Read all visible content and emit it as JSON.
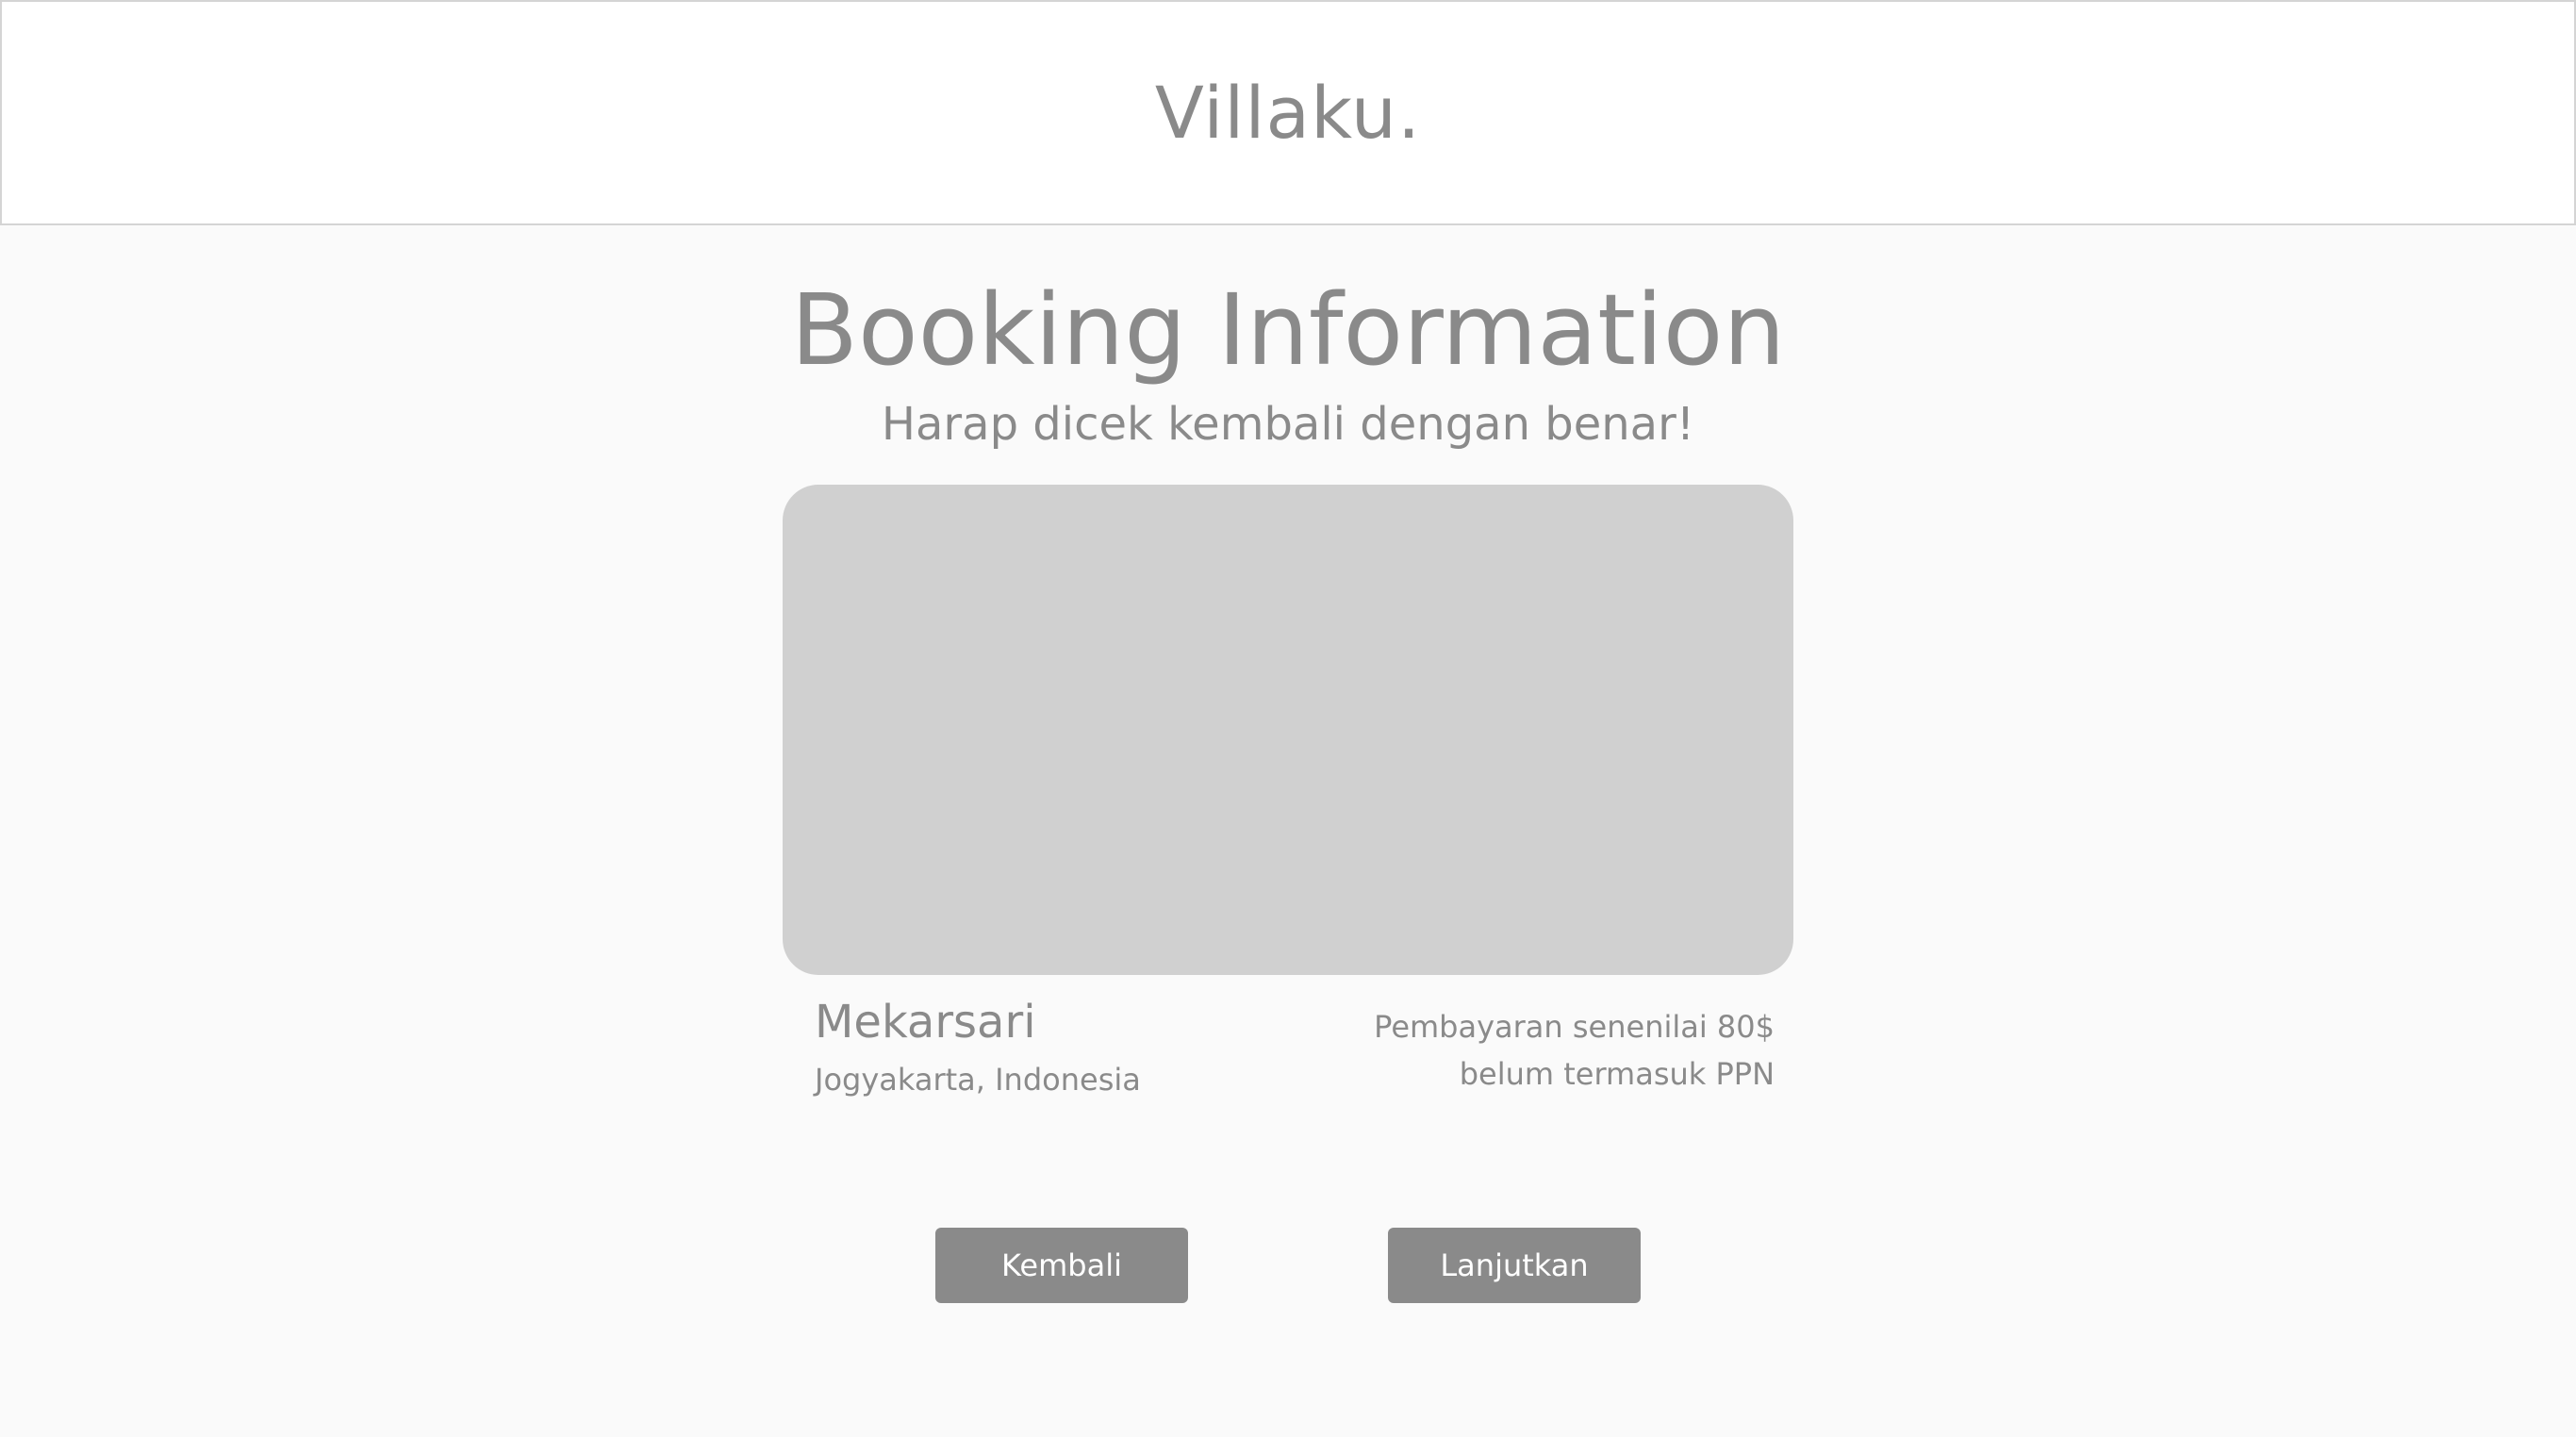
{
  "header": {
    "brand": "Villaku."
  },
  "main": {
    "title": "Booking Information",
    "subtitle": "Harap dicek kembali dengan benar!",
    "villa": {
      "name": "Mekarsari",
      "location": "Jogyakarta, Indonesia"
    },
    "payment": {
      "line1": "Pembayaran senenilai 80$",
      "line2": "belum termasuk PPN"
    }
  },
  "actions": {
    "back_label": "Kembali",
    "next_label": "Lanjutkan"
  },
  "colors": {
    "text_gray": "#8a8a8a",
    "placeholder_gray": "#d0d0d0",
    "background": "#fafafa",
    "button": "#8a8a8a"
  }
}
